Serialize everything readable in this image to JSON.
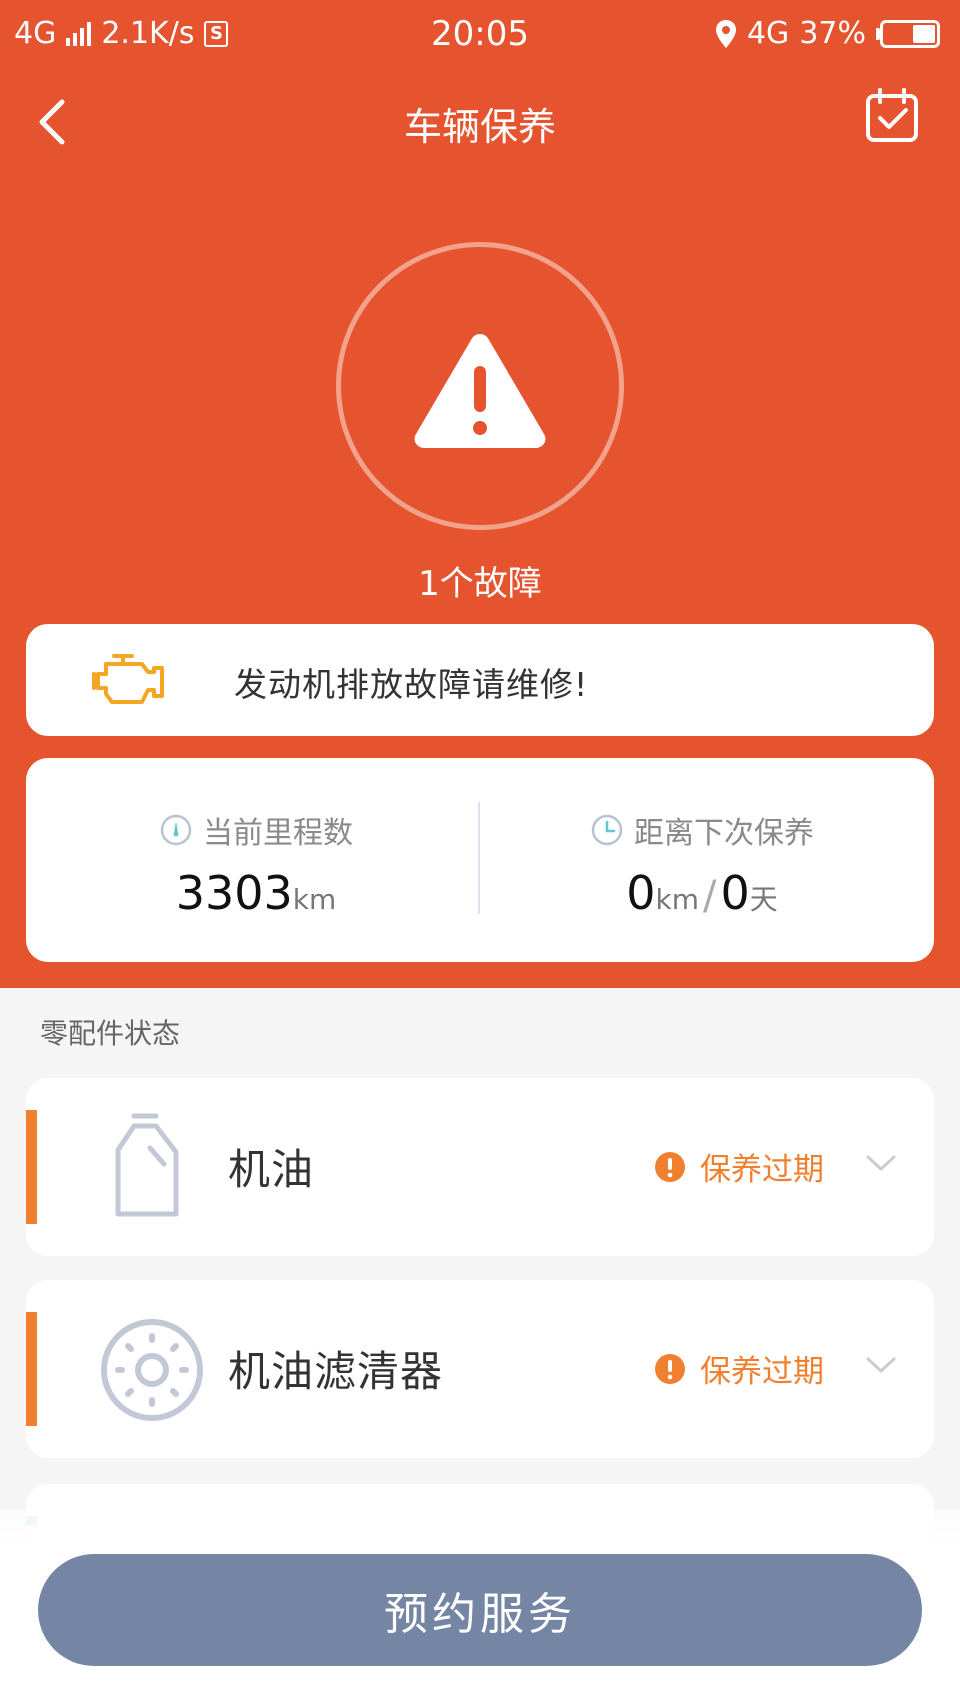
{
  "status_bar": {
    "network_left": "4G",
    "speed": "2.1K/s",
    "s_badge": "S",
    "time": "20:05",
    "network_right": "4G",
    "battery": "37%"
  },
  "nav": {
    "title": "车辆保养"
  },
  "fault": {
    "count_text": "1个故障",
    "message": "发动机排放故障请维修!"
  },
  "stats": {
    "mileage_label": "当前里程数",
    "mileage_value": "3303",
    "mileage_unit": "km",
    "next_label": "距离下次保养",
    "next_km_value": "0",
    "next_km_unit": "km",
    "slash": "/",
    "next_days_value": "0",
    "next_days_unit": "天"
  },
  "parts": {
    "section_title": "零配件状态",
    "items": [
      {
        "name": "机油",
        "status": "保养过期",
        "icon": "oil-bottle-icon"
      },
      {
        "name": "机油滤清器",
        "status": "保养过期",
        "icon": "oil-filter-icon"
      }
    ]
  },
  "actions": {
    "book_label": "预约服务"
  },
  "colors": {
    "primary": "#e5542f",
    "accent": "#f07e2f",
    "button": "#7586a5"
  }
}
